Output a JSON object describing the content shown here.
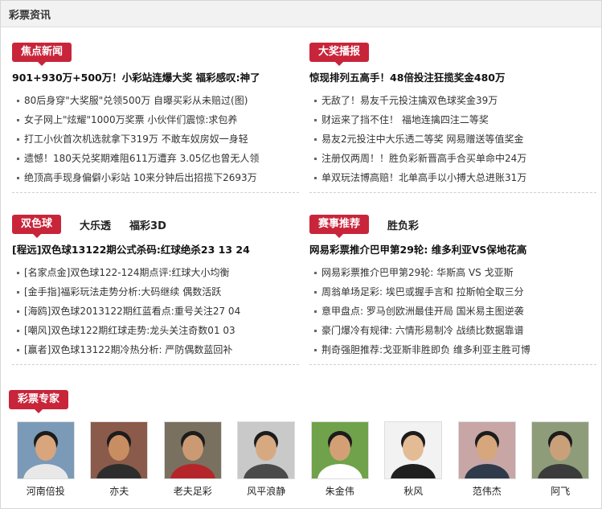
{
  "header": {
    "title": "彩票资讯"
  },
  "sections": {
    "focus": {
      "tag": "焦点新闻",
      "headline": "901+930万+500万！小彩站连爆大奖 福彩感叹:神了",
      "items": [
        "80后身穿\"大奖服\"兑领500万 自曝买彩从未赔过(图)",
        "女子网上\"炫耀\"1000万奖票 小伙伴们震惊:求包养",
        "打工小伙首次机选就拿下319万 不敢车奴房奴一身轻",
        "遗憾！180天兑奖期难阻611万遭弃 3.05亿也曾无人领",
        "绝顶高手现身偏僻小彩站 10来分钟后出招揽下2693万"
      ]
    },
    "big": {
      "tag": "大奖播报",
      "headline": "惊现排列五高手！48倍投注狂揽奖金480万",
      "items": [
        "无敌了！易友千元投注擒双色球奖金39万",
        "财运来了挡不住！ 福地连擒四注二等奖",
        "易友2元投注中大乐透二等奖 网易赠送等值奖金",
        "注册仅两周！！胜负彩新晋高手合买单命中24万",
        "单双玩法博高赔！北单高手以小搏大总进账31万"
      ]
    },
    "lottery": {
      "tag": "双色球",
      "tabs": [
        "大乐透",
        "福彩3D"
      ],
      "headline": "[程远]双色球13122期公式杀码:红球绝杀23 13 24",
      "items": [
        "[名家点金]双色球122-124期点评:红球大小均衡",
        "[金手指]福彩玩法走势分析:大码继续 偶数活跃",
        "[海鸥]双色球2013122期红蓝看点:重号关注27 04",
        "[嘲风]双色球122期红球走势:龙头关注奇数01 03",
        "[赢者]双色球13122期冷热分析: 严防偶数蓝回补"
      ]
    },
    "match": {
      "tag": "赛事推荐",
      "tabs": [
        "胜负彩"
      ],
      "headline": "网易彩票推介巴甲第29轮: 维多利亚VS保地花高",
      "items": [
        "网易彩票推介巴甲第29轮: 华斯高 VS 戈亚斯",
        "周翁单场足彩: 埃巴或握手言和 拉斯帕全取三分",
        "意甲盘点: 罗马创欧洲最佳开局 国米易主图逆袭",
        "豪门爆冷有规律: 六情形易制冷 战绩比数据靠谱",
        "荆奇强胆推荐:戈亚斯非胜即负 维多利亚主胜可博"
      ]
    }
  },
  "experts": {
    "tag": "彩票专家",
    "list": [
      {
        "name": "河南倍投",
        "bg": "#7a9ab8",
        "face": "#d9a57d",
        "shirt": "#e8e8e8"
      },
      {
        "name": "亦夫",
        "bg": "#8a5a4a",
        "face": "#c98d62",
        "shirt": "#2d2d2d"
      },
      {
        "name": "老夫足彩",
        "bg": "#7a7060",
        "face": "#cc9a72",
        "shirt": "#b5262a"
      },
      {
        "name": "风平浪静",
        "bg": "#c9c9c9",
        "face": "#d7a981",
        "shirt": "#4a4a4a"
      },
      {
        "name": "朱金伟",
        "bg": "#6fa24a",
        "face": "#d3a076",
        "shirt": "#ffffff"
      },
      {
        "name": "秋风",
        "bg": "#f2f2f2",
        "face": "#e3bb95",
        "shirt": "#1f1f1f"
      },
      {
        "name": "范伟杰",
        "bg": "#c8a6a6",
        "face": "#d6a67c",
        "shirt": "#2f3a4a"
      },
      {
        "name": "阿飞",
        "bg": "#8e9c7a",
        "face": "#caa07a",
        "shirt": "#3b3b3b"
      }
    ]
  }
}
